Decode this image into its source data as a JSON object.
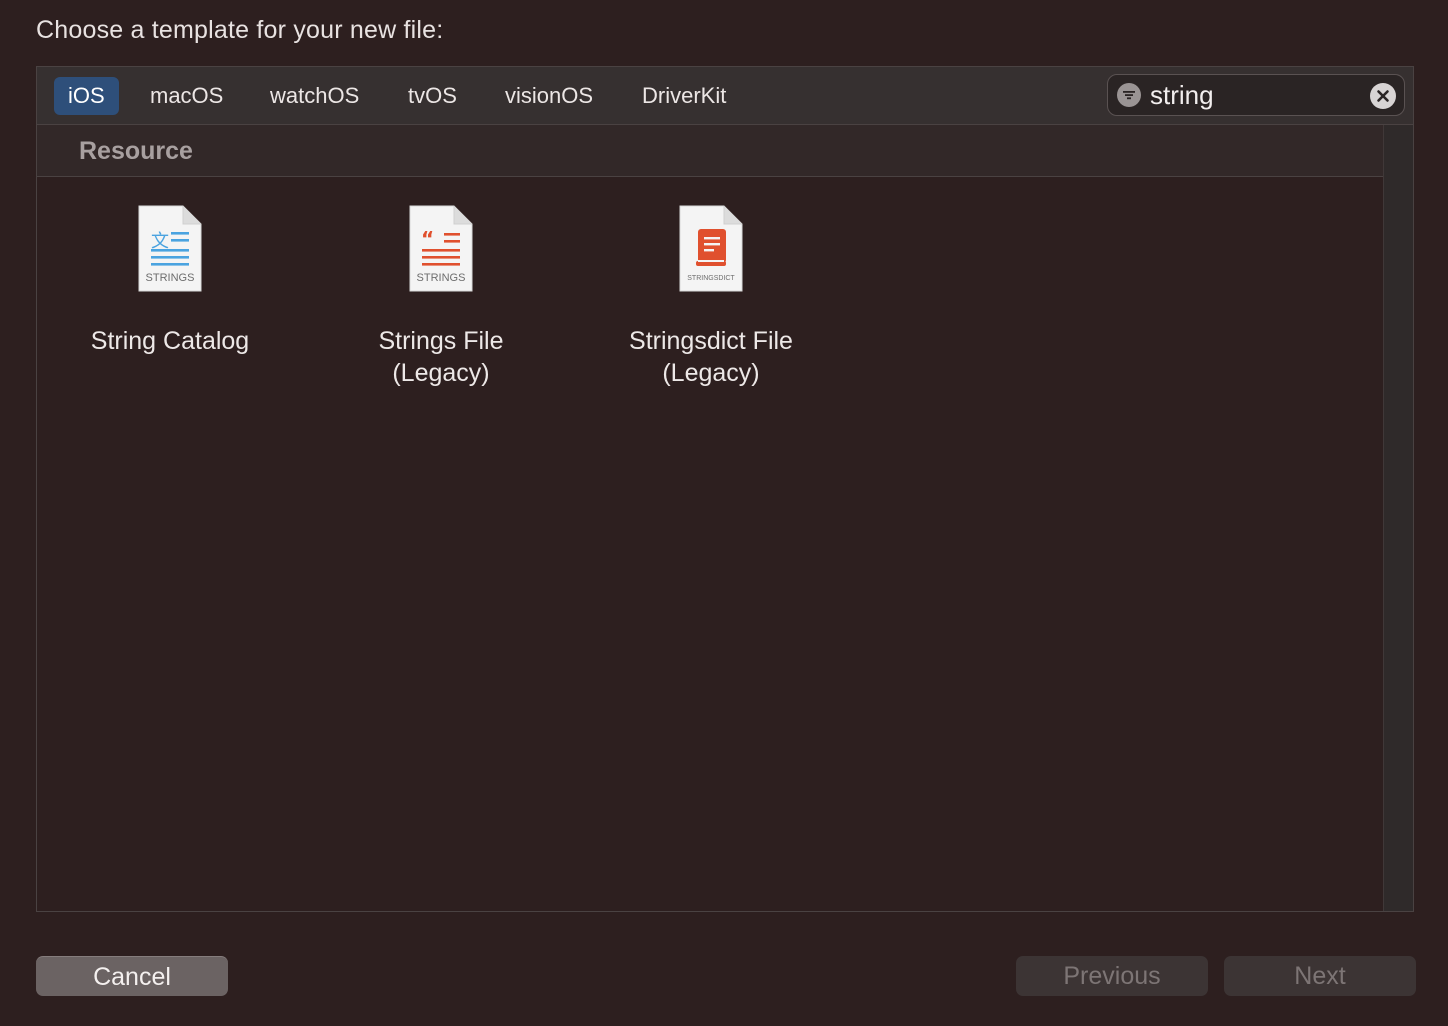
{
  "dialog": {
    "title": "Choose a template for your new file:"
  },
  "platform_tabs": [
    {
      "label": "iOS",
      "selected": true
    },
    {
      "label": "macOS",
      "selected": false
    },
    {
      "label": "watchOS",
      "selected": false
    },
    {
      "label": "tvOS",
      "selected": false
    },
    {
      "label": "visionOS",
      "selected": false
    },
    {
      "label": "DriverKit",
      "selected": false
    }
  ],
  "search": {
    "value": "string",
    "icons": [
      "filter-icon",
      "clear-icon"
    ]
  },
  "section": {
    "title": "Resource"
  },
  "templates": [
    {
      "label_line1": "String Catalog",
      "label_line2": "",
      "badge": "STRINGS",
      "icon": "string-catalog-icon",
      "accent": "#4aa3e0"
    },
    {
      "label_line1": "Strings File",
      "label_line2": "(Legacy)",
      "badge": "STRINGS",
      "icon": "strings-file-icon",
      "accent": "#e0502e"
    },
    {
      "label_line1": "Stringsdict File",
      "label_line2": "(Legacy)",
      "badge": "STRINGSDICT",
      "icon": "stringsdict-file-icon",
      "accent": "#e0502e"
    }
  ],
  "buttons": {
    "cancel": "Cancel",
    "previous": "Previous",
    "next": "Next"
  },
  "colors": {
    "background": "#2d1f1f",
    "tab_selected": "#2e4f7a",
    "string_catalog_accent": "#4aa3e0",
    "legacy_accent": "#e0502e"
  }
}
